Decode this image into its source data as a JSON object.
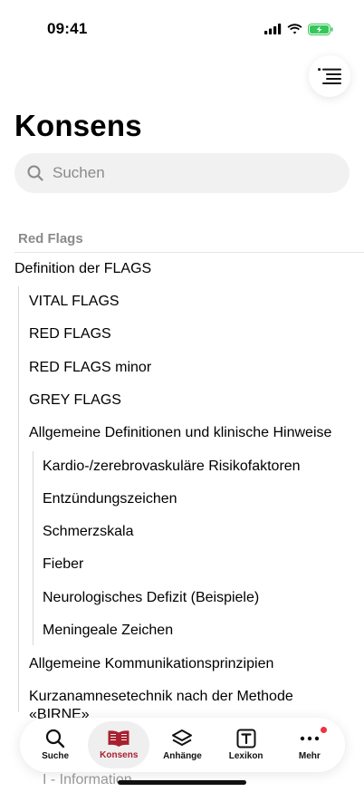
{
  "status": {
    "time": "09:41"
  },
  "header": {
    "title": "Konsens"
  },
  "search": {
    "placeholder": "Suchen"
  },
  "section": {
    "label": "Red Flags"
  },
  "toc": {
    "definition": "Definition der FLAGS",
    "vital": "VITAL FLAGS",
    "red": "RED FLAGS",
    "red_minor": "RED FLAGS minor",
    "grey": "GREY FLAGS",
    "allgemein": "Allgemeine Definitionen und klinische Hinweise",
    "kardio": "Kardio-/zerebrovaskuläre Risikofaktoren",
    "entzuendung": "Entzündungszeichen",
    "schmerz": "Schmerzskala",
    "fieber": "Fieber",
    "neuro": "Neurologisches Defizit (Beispiele)",
    "meningeal": "Meningeale Zeichen",
    "kommunikation": "Allgemeine Kommunikationsprinzipien",
    "kurzanamnese_1": "Kurzanamnesetechnik nach der Methode",
    "kurzanamnese_2": "«BIRNE»",
    "information": "I - Information"
  },
  "tabbar": {
    "suche": "Suche",
    "konsens": "Konsens",
    "anhaenge": "Anhänge",
    "lexikon": "Lexikon",
    "mehr": "Mehr"
  },
  "colors": {
    "accent": "#a8202f",
    "badge": "#ef3340",
    "battery": "#34c759"
  }
}
